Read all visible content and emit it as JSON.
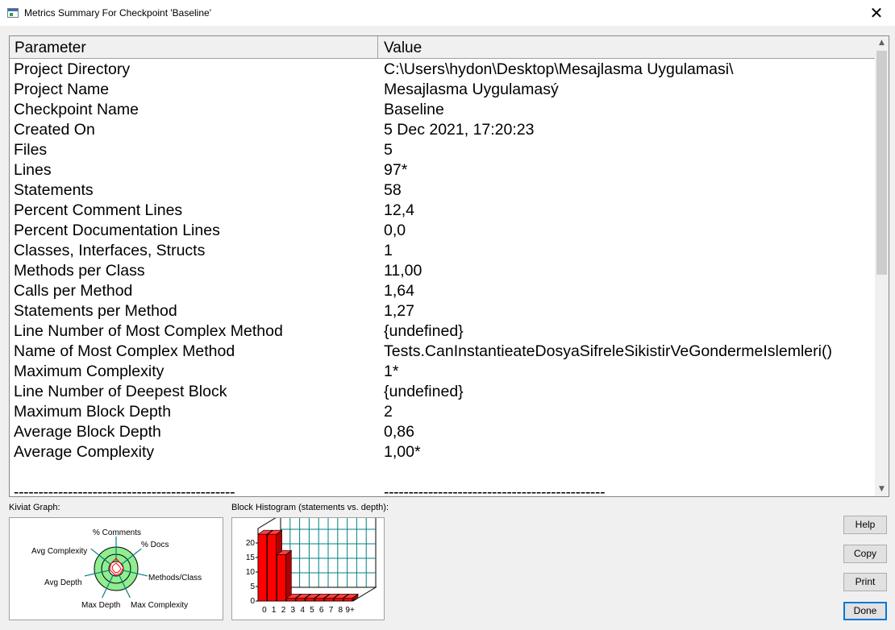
{
  "window": {
    "title": "Metrics Summary For Checkpoint 'Baseline'",
    "close_glyph": "✕"
  },
  "table": {
    "headers": {
      "parameter": "Parameter",
      "value": "Value"
    },
    "rows": [
      {
        "parameter": "Project Directory",
        "value": "C:\\Users\\hydon\\Desktop\\Mesajlasma Uygulamasi\\"
      },
      {
        "parameter": "Project Name",
        "value": "Mesajlasma Uygulamasý"
      },
      {
        "parameter": "Checkpoint Name",
        "value": "Baseline"
      },
      {
        "parameter": "Created On",
        "value": "5 Dec 2021, 17:20:23"
      },
      {
        "parameter": "Files",
        "value": "5"
      },
      {
        "parameter": "Lines",
        "value": "97*"
      },
      {
        "parameter": "Statements",
        "value": "58"
      },
      {
        "parameter": "Percent Comment Lines",
        "value": "12,4"
      },
      {
        "parameter": "Percent Documentation Lines",
        "value": "0,0"
      },
      {
        "parameter": "Classes, Interfaces, Structs",
        "value": "1"
      },
      {
        "parameter": "Methods per Class",
        "value": "11,00"
      },
      {
        "parameter": "Calls per Method",
        "value": "1,64"
      },
      {
        "parameter": "Statements per Method",
        "value": "1,27"
      },
      {
        "parameter": "Line Number of Most Complex Method",
        "value": "{undefined}"
      },
      {
        "parameter": "Name of Most Complex Method",
        "value": "Tests.CanInstantieateDosyaSifreleSikistirVeGondermeIslemleri()"
      },
      {
        "parameter": "Maximum Complexity",
        "value": "1*"
      },
      {
        "parameter": "Line Number of Deepest Block",
        "value": "{undefined}"
      },
      {
        "parameter": "Maximum Block Depth",
        "value": "2"
      },
      {
        "parameter": "Average Block Depth",
        "value": "0,86"
      },
      {
        "parameter": "Average Complexity",
        "value": "1,00*"
      },
      {
        "parameter": "",
        "value": ""
      },
      {
        "parameter": "---------------------------------------------",
        "value": "---------------------------------------------"
      }
    ]
  },
  "kiviat": {
    "label": "Kiviat Graph:",
    "axes": [
      "% Comments",
      "% Docs",
      "Methods/Class",
      "Max Complexity",
      "Max Depth",
      "Avg Depth",
      "Avg Complexity"
    ]
  },
  "histogram": {
    "label": "Block Histogram (statements vs. depth):",
    "y_ticks": [
      "20",
      "15",
      "10",
      "5",
      "0"
    ],
    "x_ticks": [
      "0",
      "1",
      "2",
      "3",
      "4",
      "5",
      "6",
      "7",
      "8",
      "9+"
    ],
    "bar_color": "#ff0000"
  },
  "chart_data": {
    "type": "bar",
    "categories": [
      "0",
      "1",
      "2",
      "3",
      "4",
      "5",
      "6",
      "7",
      "8",
      "9+"
    ],
    "values": [
      23,
      23,
      16,
      1,
      1,
      1,
      1,
      1,
      1,
      1
    ],
    "title": "Block Histogram (statements vs. depth):",
    "xlabel": "",
    "ylabel": "",
    "ylim": [
      0,
      25
    ],
    "grid": true
  },
  "buttons": {
    "help": "Help",
    "copy": "Copy",
    "print": "Print",
    "done": "Done"
  },
  "colors": {
    "ring_fill": "#90ee90",
    "bar": "#ff0000",
    "grid_line": "#008080",
    "axis_spoke": "#008080"
  }
}
